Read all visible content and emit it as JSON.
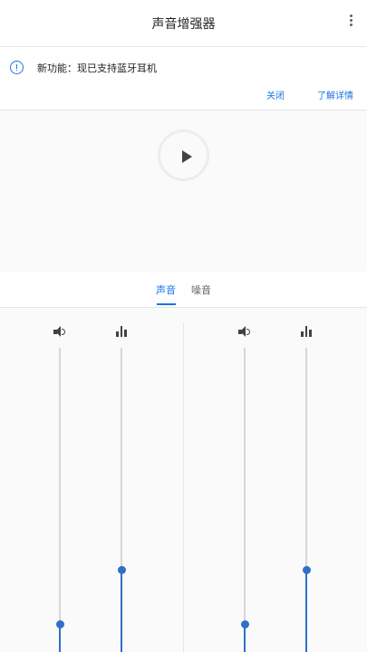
{
  "app": {
    "title": "声音增强器",
    "menu_icon": "more-vert-icon"
  },
  "banner": {
    "icon": "info-icon",
    "message": "新功能：现已支持蓝牙耳机",
    "close_label": "关闭",
    "learn_more_label": "了解详情"
  },
  "player": {
    "play_icon": "play-icon"
  },
  "tabs": [
    {
      "label": "声音",
      "selected": true
    },
    {
      "label": "噪音",
      "selected": false
    }
  ],
  "mixer": {
    "left": {
      "volume": {
        "icon": "volume-icon",
        "level": 0.09
      },
      "equalizer": {
        "icon": "equalizer-icon",
        "level": 0.27
      }
    },
    "right": {
      "volume": {
        "icon": "volume-icon",
        "level": 0.09
      },
      "equalizer": {
        "icon": "equalizer-icon",
        "level": 0.27
      }
    }
  },
  "colors": {
    "accent": "#1a73e8",
    "slider": "#2f6fc7",
    "track": "#d7d7d7"
  }
}
